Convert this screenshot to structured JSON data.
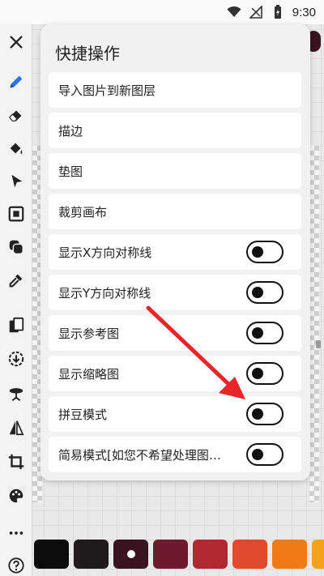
{
  "status_bar": {
    "time": "9:30",
    "icons": [
      "wifi-icon",
      "signal-icon",
      "battery-charging-icon"
    ]
  },
  "toolbar": {
    "tools": [
      "close-icon",
      "pencil-icon",
      "eraser-icon",
      "fill-bucket-icon",
      "select-arrow-icon",
      "frame-select-icon",
      "layers-icon",
      "eyedropper-icon",
      "copy-paste-icon",
      "download-icon",
      "lamp-icon",
      "flip-icon",
      "crop-icon",
      "palette-icon",
      "more-icon",
      "help-icon"
    ]
  },
  "panel": {
    "title": "快捷操作",
    "items": [
      {
        "label": "导入图片到新图层",
        "has_toggle": false
      },
      {
        "label": "描边",
        "has_toggle": false
      },
      {
        "label": "垫图",
        "has_toggle": false
      },
      {
        "label": "裁剪画布",
        "has_toggle": false
      },
      {
        "label": "显示X方向对称线",
        "has_toggle": true,
        "on": false
      },
      {
        "label": "显示Y方向对称线",
        "has_toggle": true,
        "on": false
      },
      {
        "label": "显示参考图",
        "has_toggle": true,
        "on": false
      },
      {
        "label": "显示缩略图",
        "has_toggle": true,
        "on": false
      },
      {
        "label": "拼豆模式",
        "has_toggle": true,
        "on": false
      },
      {
        "label": "简易模式[如您不希望处理图…",
        "has_toggle": true,
        "on": false
      }
    ]
  },
  "palette": {
    "colors": [
      "#0c0c0c",
      "#1f1a1c",
      "#3a1320",
      "#6e1a2c",
      "#b02830",
      "#e04a2a",
      "#f07a14",
      "#f3a21a"
    ],
    "selected_index": 2
  },
  "colors": {
    "arrow": "#e8262a"
  }
}
